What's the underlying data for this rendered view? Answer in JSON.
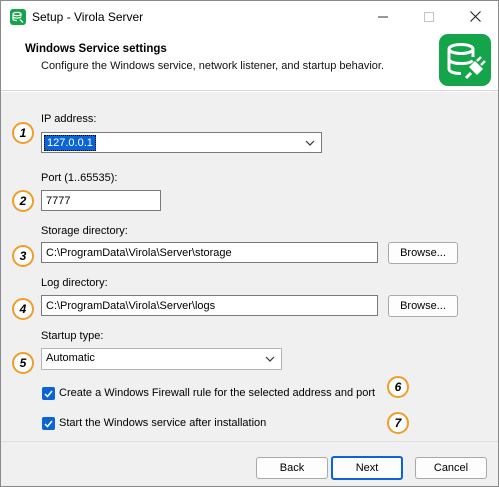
{
  "window": {
    "title": "Setup - Virola Server"
  },
  "header": {
    "title": "Windows Service settings",
    "subtitle": "Configure the Windows service, network listener, and startup behavior."
  },
  "badges": [
    "1",
    "2",
    "3",
    "4",
    "5",
    "6",
    "7"
  ],
  "fields": {
    "ip": {
      "label": "IP address:",
      "value": "127.0.0.1"
    },
    "port": {
      "label": "Port (1..65535):",
      "value": "7777"
    },
    "storage": {
      "label": "Storage directory:",
      "value": "C:\\ProgramData\\Virola\\Server\\storage",
      "browse": "Browse..."
    },
    "log": {
      "label": "Log directory:",
      "value": "C:\\ProgramData\\Virola\\Server\\logs",
      "browse": "Browse..."
    },
    "startup": {
      "label": "Startup type:",
      "value": "Automatic"
    }
  },
  "checkboxes": {
    "firewall": {
      "label": "Create a Windows Firewall rule for the selected address and port",
      "checked": true
    },
    "start_service": {
      "label": "Start the Windows service after installation",
      "checked": true
    }
  },
  "footer": {
    "back": "Back",
    "next": "Next",
    "cancel": "Cancel"
  },
  "colors": {
    "accent": "#0a64d6",
    "badge_border": "#f39c28",
    "logo_green": "#14a54a"
  },
  "icons": {
    "app": "virola-server-icon",
    "logo": "database-plug-icon",
    "dropdown": "chevron-down-icon",
    "check": "checkmark-icon"
  }
}
